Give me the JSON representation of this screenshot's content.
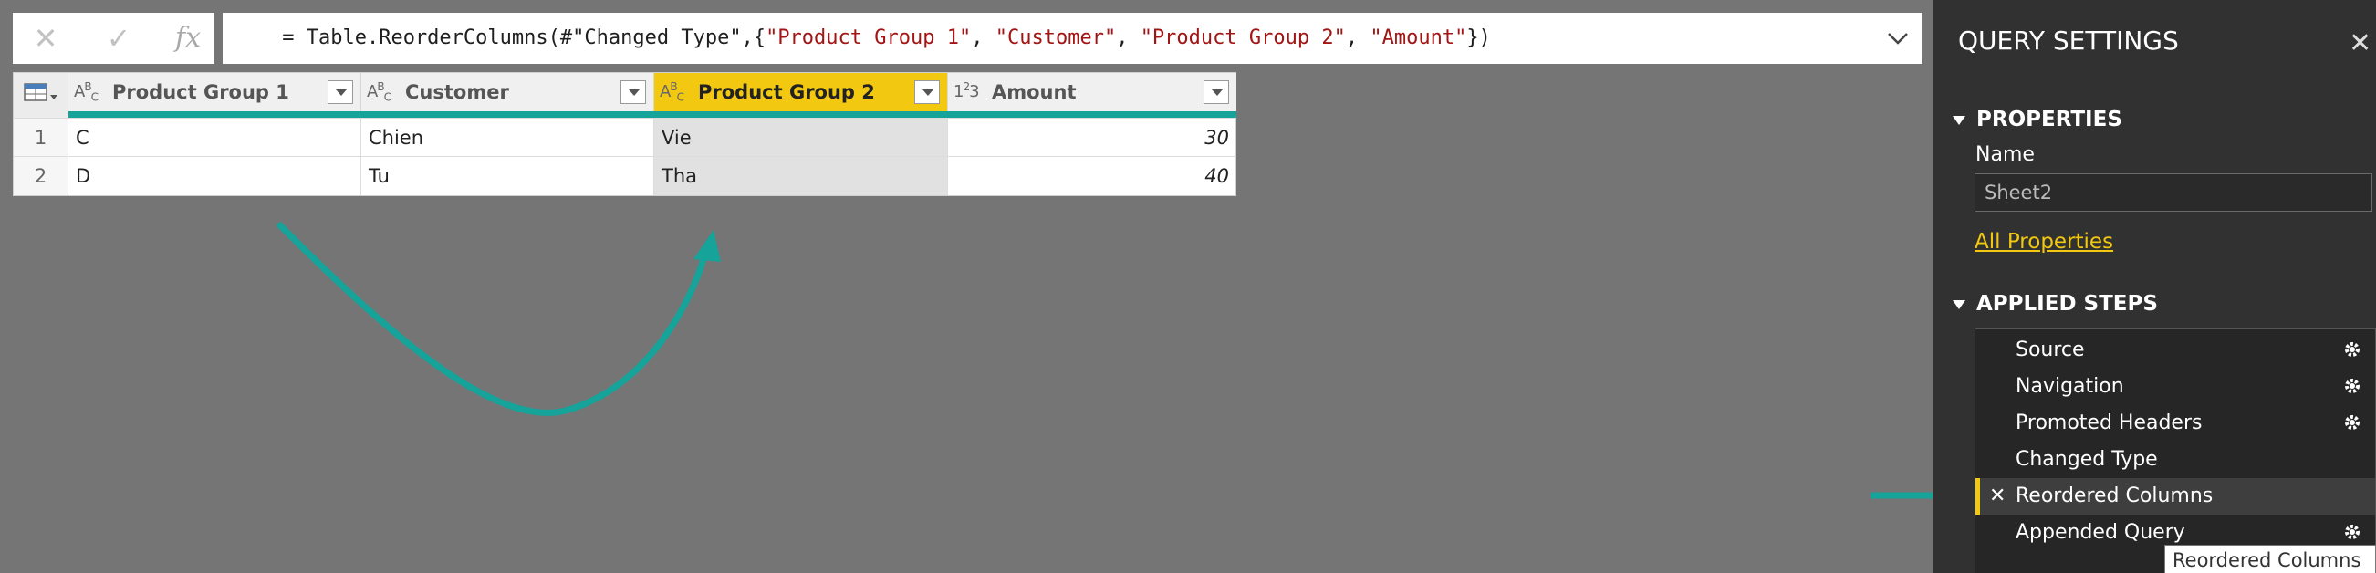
{
  "formula_bar": {
    "cancel_icon": "x-icon",
    "commit_icon": "check-icon",
    "fx_label": "fx",
    "prefix": " = Table.ReorderColumns(#\"Changed Type\",{",
    "args": [
      "\"Product Group 1\"",
      "\"Customer\"",
      "\"Product Group 2\"",
      "\"Amount\""
    ],
    "separator": ", ",
    "suffix": "})"
  },
  "table": {
    "columns": [
      {
        "type_label": "ABC",
        "name": "Product Group 1",
        "selected": false
      },
      {
        "type_label": "ABC",
        "name": "Customer",
        "selected": false
      },
      {
        "type_label": "ABC",
        "name": "Product Group 2",
        "selected": true
      },
      {
        "type_label": "123",
        "name": "Amount",
        "selected": false
      }
    ],
    "rows": [
      {
        "num": "1",
        "cells": [
          "C",
          "Chien",
          "Vie",
          "30"
        ]
      },
      {
        "num": "2",
        "cells": [
          "D",
          "Tu",
          "Tha",
          "40"
        ]
      }
    ]
  },
  "pane": {
    "title": "QUERY SETTINGS",
    "close": "✕",
    "properties_header": "PROPERTIES",
    "name_label": "Name",
    "name_value": "Sheet2",
    "all_properties": "All Properties",
    "steps_header": "APPLIED STEPS",
    "steps": [
      {
        "label": "Source",
        "gear": true,
        "selected": false
      },
      {
        "label": "Navigation",
        "gear": true,
        "selected": false
      },
      {
        "label": "Promoted Headers",
        "gear": true,
        "selected": false
      },
      {
        "label": "Changed Type",
        "gear": false,
        "selected": false
      },
      {
        "label": "Reordered Columns",
        "gear": false,
        "selected": true
      },
      {
        "label": "Appended Query",
        "gear": true,
        "selected": false
      }
    ],
    "tooltip": "Reordered Columns"
  },
  "colors": {
    "accent": "#f2c811",
    "annotation": "#15a39a"
  }
}
